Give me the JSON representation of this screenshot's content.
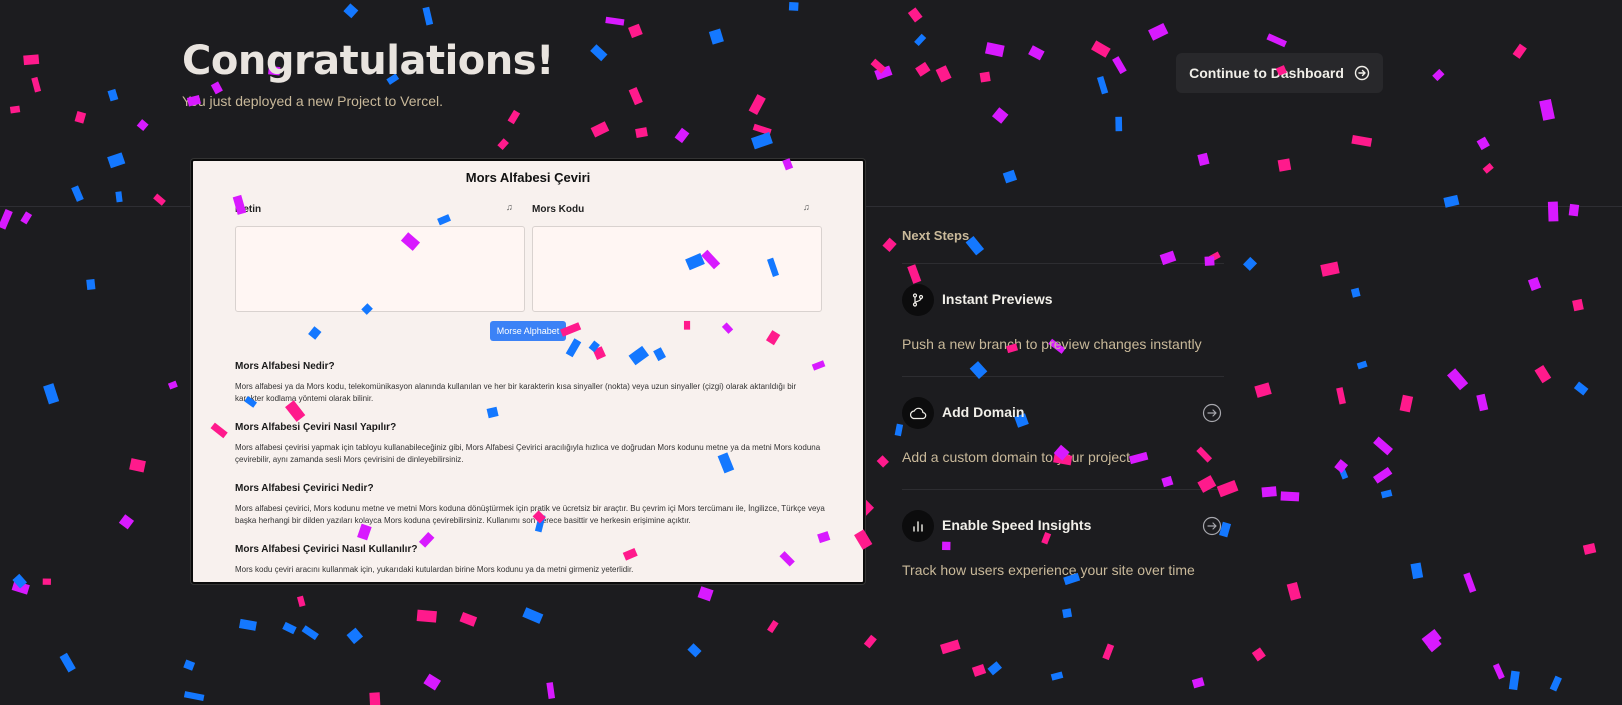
{
  "header": {
    "title": "Congratulations!",
    "subtitle": "You just deployed a new Project to Vercel.",
    "dashboard_button": "Continue to Dashboard"
  },
  "preview": {
    "title": "Mors Alfabesi Çeviri",
    "left_label": "Metin",
    "right_label": "Mors Kodu",
    "convert_button": "Morse Alphabet",
    "sections": [
      {
        "heading": "Mors Alfabesi Nedir?",
        "text": "Mors alfabesi ya da Mors kodu, telekomünikasyon alanında kullanılan ve her bir karakterin kısa sinyaller (nokta) veya uzun sinyaller (çizgi) olarak aktarıldığı bir karakter kodlama yöntemi olarak bilinir."
      },
      {
        "heading": "Mors Alfabesi Çeviri Nasıl Yapılır?",
        "text": "Mors alfabesi çevirisi yapmak için tabloyu kullanabileceğiniz gibi, Mors Alfabesi Çevirici aracılığıyla hızlıca ve doğrudan Mors kodunu metne ya da metni Mors koduna çevirebilir, aynı zamanda sesli Mors çevirisini de dinleyebilirsiniz."
      },
      {
        "heading": "Mors Alfabesi Çevirici Nedir?",
        "text": "Mors alfabesi çevirici, Mors kodunu metne ve metni Mors koduna dönüştürmek için pratik ve ücretsiz bir araçtır. Bu çevrim içi Mors tercümanı ile, İngilizce, Türkçe veya başka herhangi bir dilden yazıları kolayca Mors koduna çevirebilirsiniz. Kullanımı son derece basittir ve herkesin erişimine açıktır."
      },
      {
        "heading": "Mors Alfabesi Çevirici Nasıl Kullanılır?",
        "text": "Mors kodu çeviri aracını kullanmak için, yukarıdaki kutulardan birine Mors kodunu ya da metni girmeniz yeterlidir."
      }
    ]
  },
  "next_steps": {
    "title": "Next Steps",
    "steps": [
      {
        "name": "Instant Previews",
        "desc": "Push a new branch to preview changes instantly",
        "icon": "git-branch-icon"
      },
      {
        "name": "Add Domain",
        "desc": "Add a custom domain to your project",
        "icon": "cloud-icon"
      },
      {
        "name": "Enable Speed Insights",
        "desc": "Track how users experience your site over time",
        "icon": "bar-chart-icon"
      }
    ]
  },
  "colors": {
    "background": "#1c1c1f",
    "accent_text": "#c9b99a",
    "confetti": [
      "#ff1a8c",
      "#1478ff",
      "#d81aff"
    ]
  }
}
